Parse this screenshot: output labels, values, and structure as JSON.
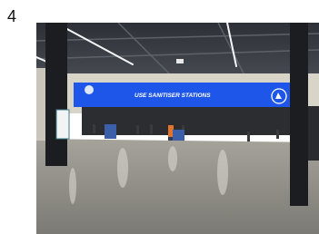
{
  "figure": {
    "number": "4"
  },
  "photo": {
    "banner": {
      "text": "USE SANITISER STATIONS"
    },
    "colors": {
      "banner": "#1d56e8",
      "ceiling": "#3a3d44",
      "floor": "#8d8c86",
      "pillar": "#1b1d20",
      "wall": "#d9d4c8"
    }
  }
}
